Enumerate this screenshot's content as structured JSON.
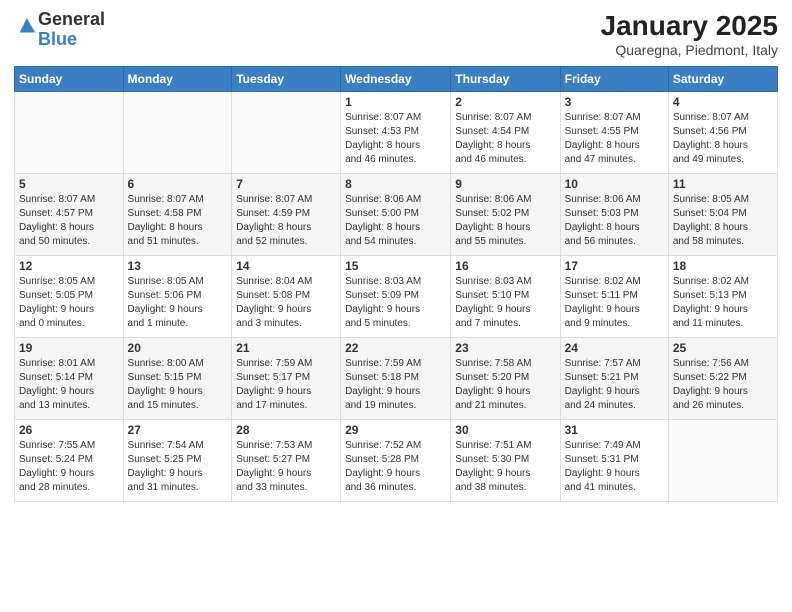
{
  "header": {
    "logo_general": "General",
    "logo_blue": "Blue",
    "title": "January 2025",
    "subtitle": "Quaregna, Piedmont, Italy"
  },
  "weekdays": [
    "Sunday",
    "Monday",
    "Tuesday",
    "Wednesday",
    "Thursday",
    "Friday",
    "Saturday"
  ],
  "weeks": [
    [
      {
        "day": "",
        "info": ""
      },
      {
        "day": "",
        "info": ""
      },
      {
        "day": "",
        "info": ""
      },
      {
        "day": "1",
        "info": "Sunrise: 8:07 AM\nSunset: 4:53 PM\nDaylight: 8 hours\nand 46 minutes."
      },
      {
        "day": "2",
        "info": "Sunrise: 8:07 AM\nSunset: 4:54 PM\nDaylight: 8 hours\nand 46 minutes."
      },
      {
        "day": "3",
        "info": "Sunrise: 8:07 AM\nSunset: 4:55 PM\nDaylight: 8 hours\nand 47 minutes."
      },
      {
        "day": "4",
        "info": "Sunrise: 8:07 AM\nSunset: 4:56 PM\nDaylight: 8 hours\nand 49 minutes."
      }
    ],
    [
      {
        "day": "5",
        "info": "Sunrise: 8:07 AM\nSunset: 4:57 PM\nDaylight: 8 hours\nand 50 minutes."
      },
      {
        "day": "6",
        "info": "Sunrise: 8:07 AM\nSunset: 4:58 PM\nDaylight: 8 hours\nand 51 minutes."
      },
      {
        "day": "7",
        "info": "Sunrise: 8:07 AM\nSunset: 4:59 PM\nDaylight: 8 hours\nand 52 minutes."
      },
      {
        "day": "8",
        "info": "Sunrise: 8:06 AM\nSunset: 5:00 PM\nDaylight: 8 hours\nand 54 minutes."
      },
      {
        "day": "9",
        "info": "Sunrise: 8:06 AM\nSunset: 5:02 PM\nDaylight: 8 hours\nand 55 minutes."
      },
      {
        "day": "10",
        "info": "Sunrise: 8:06 AM\nSunset: 5:03 PM\nDaylight: 8 hours\nand 56 minutes."
      },
      {
        "day": "11",
        "info": "Sunrise: 8:05 AM\nSunset: 5:04 PM\nDaylight: 8 hours\nand 58 minutes."
      }
    ],
    [
      {
        "day": "12",
        "info": "Sunrise: 8:05 AM\nSunset: 5:05 PM\nDaylight: 9 hours\nand 0 minutes."
      },
      {
        "day": "13",
        "info": "Sunrise: 8:05 AM\nSunset: 5:06 PM\nDaylight: 9 hours\nand 1 minute."
      },
      {
        "day": "14",
        "info": "Sunrise: 8:04 AM\nSunset: 5:08 PM\nDaylight: 9 hours\nand 3 minutes."
      },
      {
        "day": "15",
        "info": "Sunrise: 8:03 AM\nSunset: 5:09 PM\nDaylight: 9 hours\nand 5 minutes."
      },
      {
        "day": "16",
        "info": "Sunrise: 8:03 AM\nSunset: 5:10 PM\nDaylight: 9 hours\nand 7 minutes."
      },
      {
        "day": "17",
        "info": "Sunrise: 8:02 AM\nSunset: 5:11 PM\nDaylight: 9 hours\nand 9 minutes."
      },
      {
        "day": "18",
        "info": "Sunrise: 8:02 AM\nSunset: 5:13 PM\nDaylight: 9 hours\nand 11 minutes."
      }
    ],
    [
      {
        "day": "19",
        "info": "Sunrise: 8:01 AM\nSunset: 5:14 PM\nDaylight: 9 hours\nand 13 minutes."
      },
      {
        "day": "20",
        "info": "Sunrise: 8:00 AM\nSunset: 5:15 PM\nDaylight: 9 hours\nand 15 minutes."
      },
      {
        "day": "21",
        "info": "Sunrise: 7:59 AM\nSunset: 5:17 PM\nDaylight: 9 hours\nand 17 minutes."
      },
      {
        "day": "22",
        "info": "Sunrise: 7:59 AM\nSunset: 5:18 PM\nDaylight: 9 hours\nand 19 minutes."
      },
      {
        "day": "23",
        "info": "Sunrise: 7:58 AM\nSunset: 5:20 PM\nDaylight: 9 hours\nand 21 minutes."
      },
      {
        "day": "24",
        "info": "Sunrise: 7:57 AM\nSunset: 5:21 PM\nDaylight: 9 hours\nand 24 minutes."
      },
      {
        "day": "25",
        "info": "Sunrise: 7:56 AM\nSunset: 5:22 PM\nDaylight: 9 hours\nand 26 minutes."
      }
    ],
    [
      {
        "day": "26",
        "info": "Sunrise: 7:55 AM\nSunset: 5:24 PM\nDaylight: 9 hours\nand 28 minutes."
      },
      {
        "day": "27",
        "info": "Sunrise: 7:54 AM\nSunset: 5:25 PM\nDaylight: 9 hours\nand 31 minutes."
      },
      {
        "day": "28",
        "info": "Sunrise: 7:53 AM\nSunset: 5:27 PM\nDaylight: 9 hours\nand 33 minutes."
      },
      {
        "day": "29",
        "info": "Sunrise: 7:52 AM\nSunset: 5:28 PM\nDaylight: 9 hours\nand 36 minutes."
      },
      {
        "day": "30",
        "info": "Sunrise: 7:51 AM\nSunset: 5:30 PM\nDaylight: 9 hours\nand 38 minutes."
      },
      {
        "day": "31",
        "info": "Sunrise: 7:49 AM\nSunset: 5:31 PM\nDaylight: 9 hours\nand 41 minutes."
      },
      {
        "day": "",
        "info": ""
      }
    ]
  ]
}
